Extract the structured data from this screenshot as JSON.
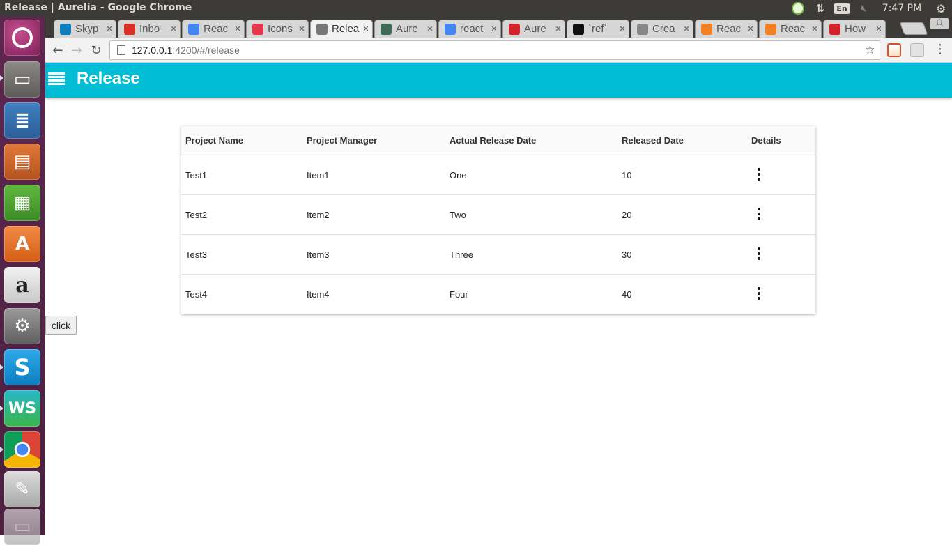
{
  "os": {
    "window_title": "Release | Aurelia - Google Chrome",
    "lang": "En",
    "time": "7:47 PM"
  },
  "browser": {
    "tabs": [
      {
        "label": "Skyp",
        "icon": "skype-icon",
        "color": "#0c7ec0"
      },
      {
        "label": "Inbo",
        "icon": "gmail-icon",
        "color": "#d93025"
      },
      {
        "label": "Reac",
        "icon": "docs-icon",
        "color": "#4285f4"
      },
      {
        "label": "Icons",
        "icon": "icons-icon",
        "color": "#e5364e"
      },
      {
        "label": "Relea",
        "icon": "page-icon",
        "color": "#777777"
      },
      {
        "label": "Aure",
        "icon": "aurelia-icon",
        "color": "#3c6b58"
      },
      {
        "label": "react",
        "icon": "google-icon",
        "color": "#4285f4"
      },
      {
        "label": "Aure",
        "icon": "aurelia-red-icon",
        "color": "#d2232a"
      },
      {
        "label": "`ref`",
        "icon": "github-icon",
        "color": "#111111"
      },
      {
        "label": "Crea",
        "icon": "list-icon",
        "color": "#888888"
      },
      {
        "label": "Reac",
        "icon": "stackoverflow-icon",
        "color": "#f48024"
      },
      {
        "label": "Reac",
        "icon": "stackoverflow-icon",
        "color": "#f48024"
      },
      {
        "label": "How",
        "icon": "aurelia-red-icon",
        "color": "#d2232a"
      }
    ],
    "active_tab": 4,
    "url_host": "127.0.0.1",
    "url_path": ":4200/#/release"
  },
  "app": {
    "title": "Release",
    "accent": "#00bcd4",
    "table": {
      "headers": [
        "Project Name",
        "Project Manager",
        "Actual Release Date",
        "Released Date",
        "Details"
      ],
      "rows": [
        [
          "Test1",
          "Item1",
          "One",
          "10"
        ],
        [
          "Test2",
          "Item2",
          "Two",
          "20"
        ],
        [
          "Test3",
          "Item3",
          "Three",
          "30"
        ],
        [
          "Test4",
          "Item4",
          "Four",
          "40"
        ]
      ]
    },
    "click_button": "click"
  }
}
